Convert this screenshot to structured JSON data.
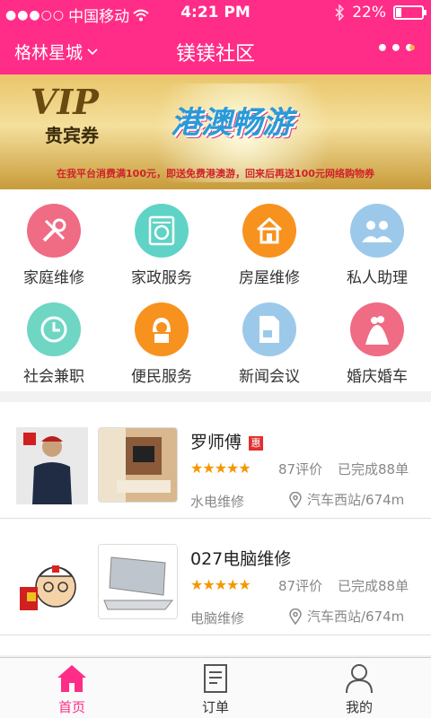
{
  "status_bar": {
    "carrier": "中国移动",
    "time": "4:21 PM",
    "battery": "22%",
    "battery_level": 0.22
  },
  "nav": {
    "city": "格林星城",
    "title": "镁镁社区"
  },
  "banner": {
    "vip": "VIP",
    "vip_sub": "贵宾券",
    "headline": "港澳畅游",
    "caption": "在我平台消费满100元，即送免费港澳游，回来后再送100元网络购物券"
  },
  "services": [
    {
      "label": "家庭维修",
      "icon": "wrench-screwdriver-icon",
      "color": "#f06b84"
    },
    {
      "label": "家政服务",
      "icon": "washing-machine-icon",
      "color": "#5fd3c5"
    },
    {
      "label": "房屋维修",
      "icon": "house-brush-icon",
      "color": "#f7921e"
    },
    {
      "label": "私人助理",
      "icon": "people-icon",
      "color": "#9cc9ea"
    },
    {
      "label": "社会兼职",
      "icon": "clock-icon",
      "color": "#6fd6c4"
    },
    {
      "label": "便民服务",
      "icon": "woman-icon",
      "color": "#f7921e"
    },
    {
      "label": "新闻会议",
      "icon": "news-photo-icon",
      "color": "#9cc9ea"
    },
    {
      "label": "婚庆婚车",
      "icon": "wedding-icon",
      "color": "#f06b84"
    }
  ],
  "providers": [
    {
      "name": "罗师傅",
      "badge": "惠",
      "rating": 5,
      "reviews": "87评价",
      "completed": "已完成88单",
      "category": "水电维修",
      "location": "汽车西站/674m"
    },
    {
      "name": "027电脑维修",
      "badge": "",
      "rating": 5,
      "reviews": "87评价",
      "completed": "已完成88单",
      "category": "电脑维修",
      "location": "汽车西站/674m"
    }
  ],
  "tabs": [
    {
      "label": "首页",
      "icon": "home-icon",
      "active": true
    },
    {
      "label": "订单",
      "icon": "order-list-icon",
      "active": false
    },
    {
      "label": "我的",
      "icon": "user-icon",
      "active": false
    }
  ],
  "colors": {
    "brand": "#ff2d87",
    "star": "#f39800"
  }
}
